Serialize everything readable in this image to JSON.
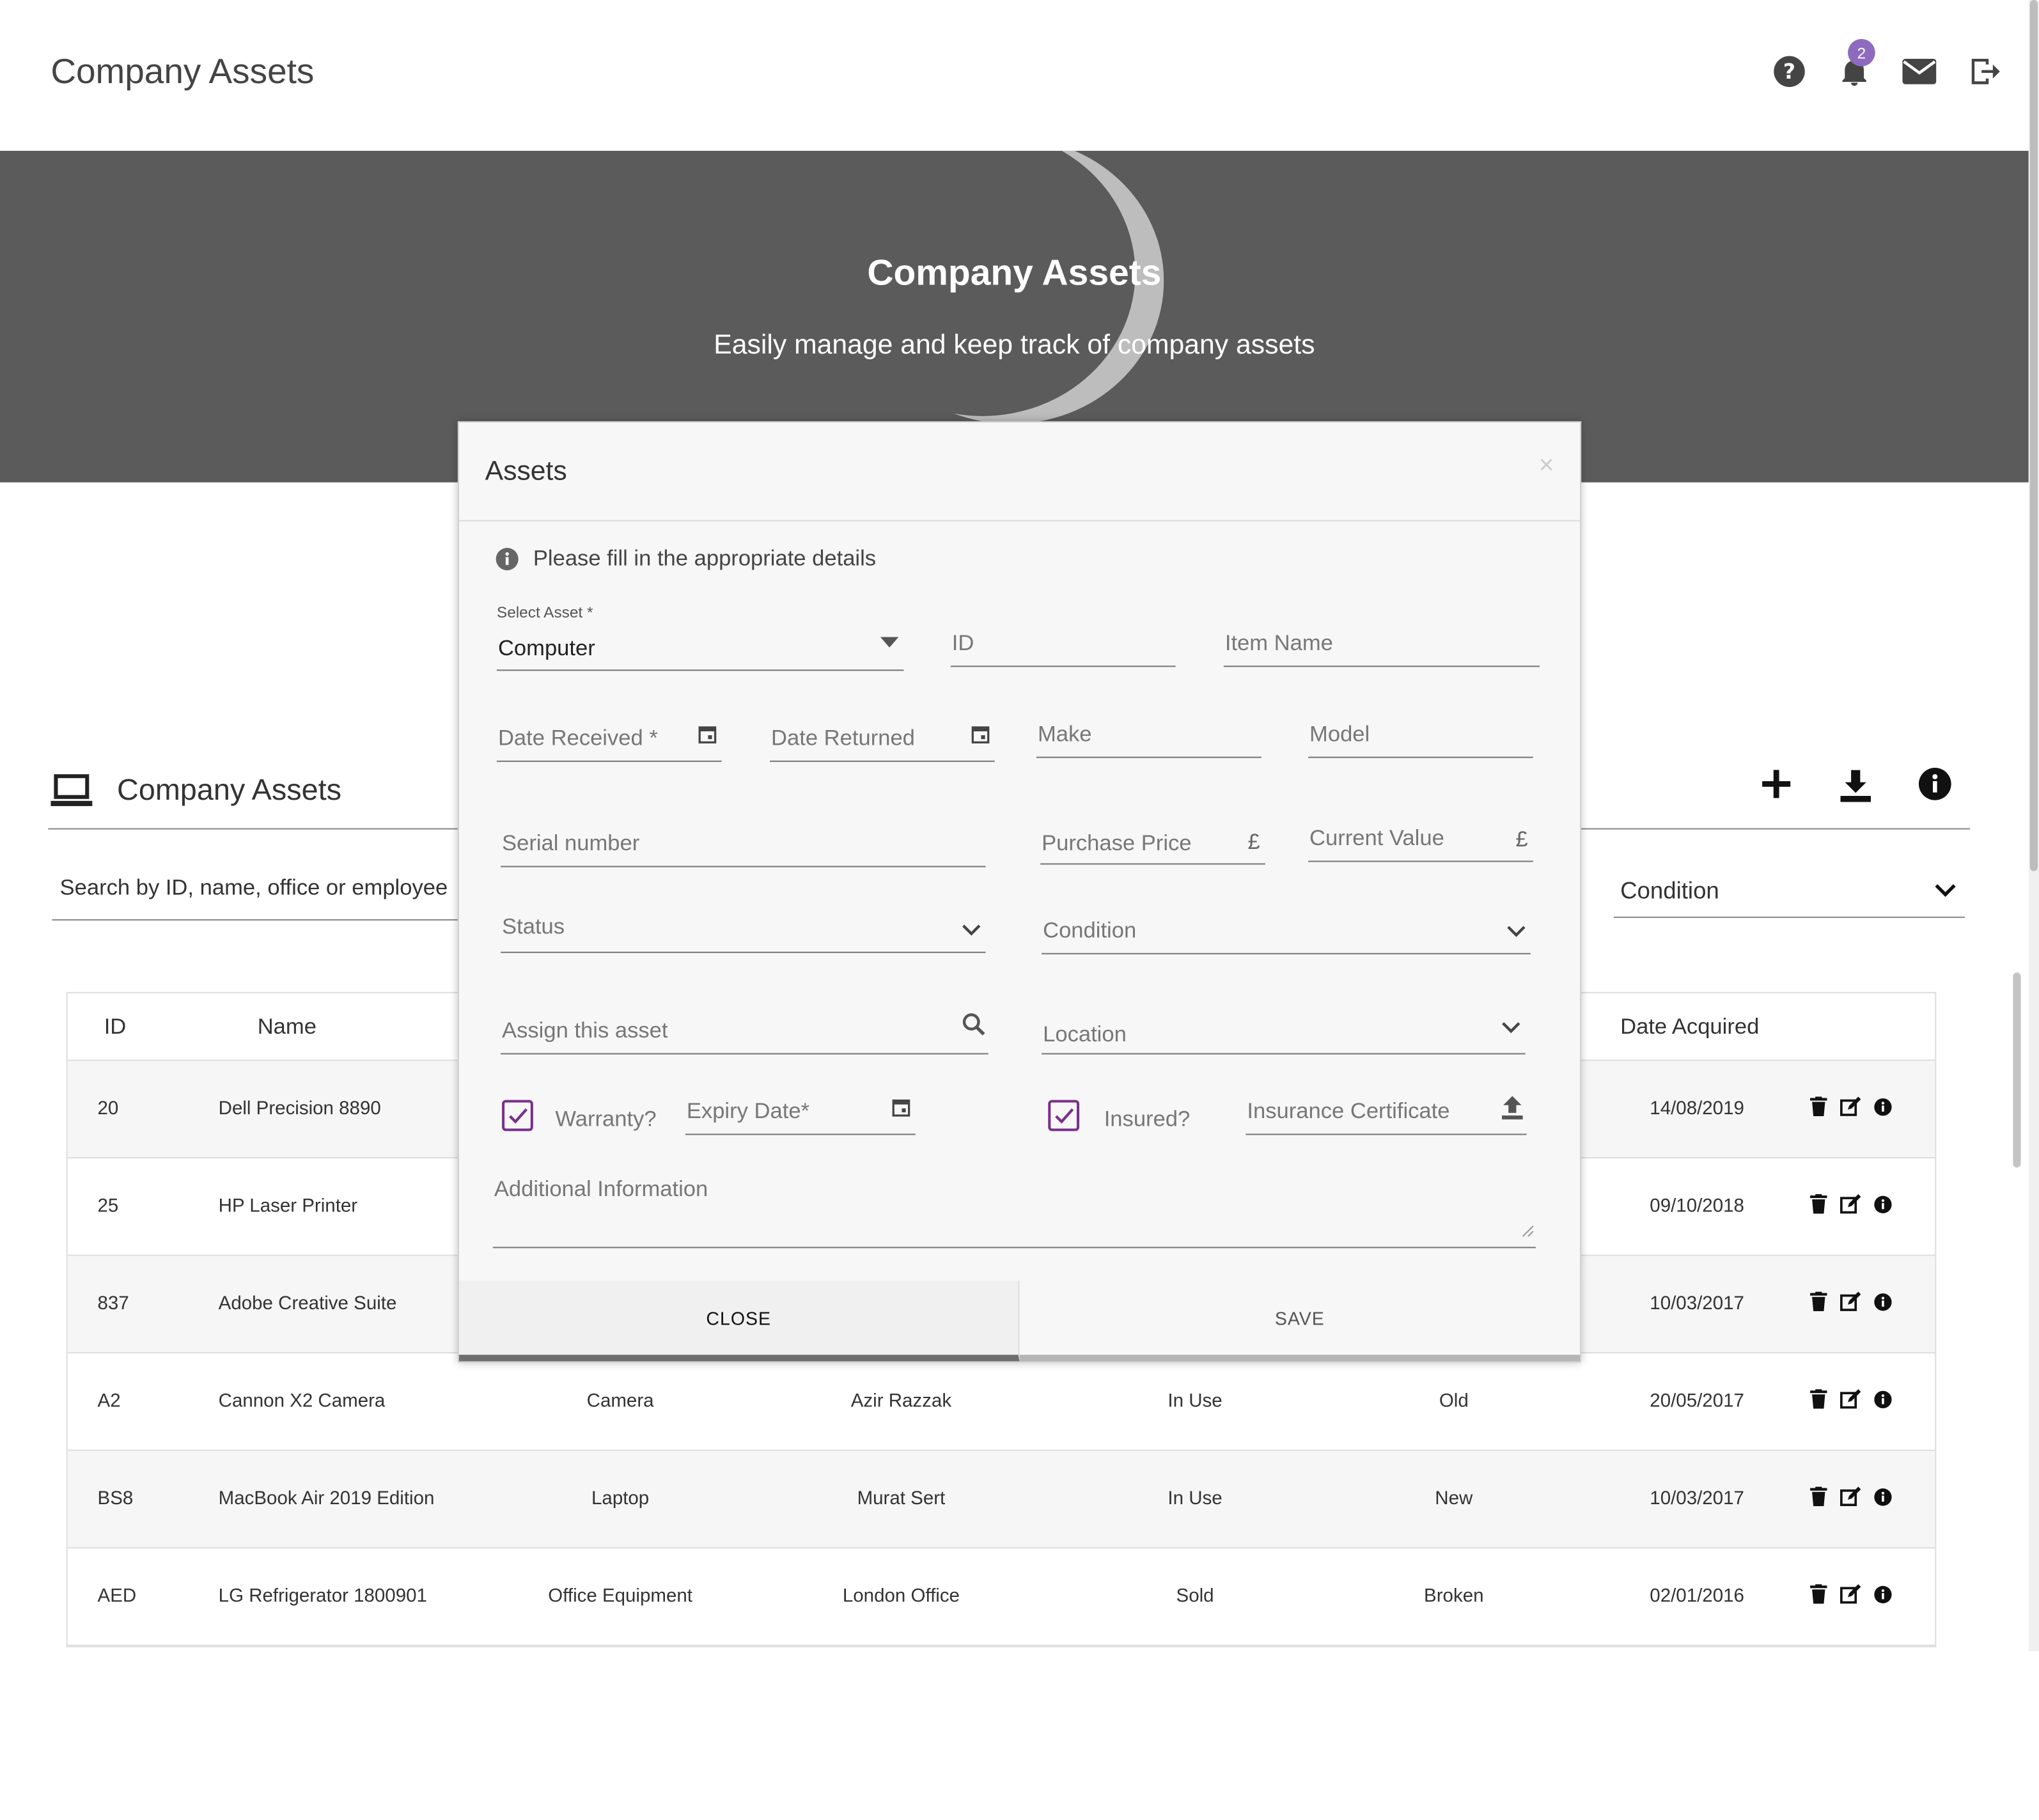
{
  "header": {
    "title": "Company Assets",
    "notification_count": "2"
  },
  "hero": {
    "title": "Company Assets",
    "subtitle": "Easily manage and keep track of company assets"
  },
  "section": {
    "title": "Company Assets"
  },
  "search": {
    "placeholder": "Search by ID, name, office or employee"
  },
  "filter": {
    "condition_label": "Condition"
  },
  "table": {
    "headers": {
      "id": "ID",
      "name": "Name",
      "date": "Date Acquired"
    },
    "rows": [
      {
        "id": "20",
        "name": "Dell Precision 8890",
        "type": "",
        "assignee": "",
        "status": "",
        "condition": "",
        "date": "14/08/2019"
      },
      {
        "id": "25",
        "name": "HP Laser Printer",
        "type": "",
        "assignee": "",
        "status": "",
        "condition": "",
        "date": "09/10/2018"
      },
      {
        "id": "837",
        "name": "Adobe Creative Suite",
        "type": "",
        "assignee": "",
        "status": "",
        "condition": "",
        "date": "10/03/2017"
      },
      {
        "id": "A2",
        "name": "Cannon X2 Camera",
        "type": "Camera",
        "assignee": "Azir Razzak",
        "status": "In Use",
        "condition": "Old",
        "date": "20/05/2017"
      },
      {
        "id": "BS8",
        "name": "MacBook Air 2019 Edition",
        "type": "Laptop",
        "assignee": "Murat Sert",
        "status": "In Use",
        "condition": "New",
        "date": "10/03/2017"
      },
      {
        "id": "AED",
        "name": "LG Refrigerator 1800901",
        "type": "Office Equipment",
        "assignee": "London Office",
        "status": "Sold",
        "condition": "Broken",
        "date": "02/01/2016"
      }
    ]
  },
  "modal": {
    "title": "Assets",
    "close_x": "×",
    "info": "Please fill in the appropriate details",
    "select_asset_label": "Select Asset *",
    "select_asset_value": "Computer",
    "id_placeholder": "ID",
    "item_name_placeholder": "Item Name",
    "date_received_placeholder": "Date Received *",
    "date_returned_placeholder": "Date Returned",
    "make_placeholder": "Make",
    "model_placeholder": "Model",
    "serial_placeholder": "Serial number",
    "purchase_price_placeholder": "Purchase Price",
    "current_value_placeholder": "Current Value",
    "currency": "£",
    "status_placeholder": "Status",
    "condition_placeholder": "Condition",
    "assign_placeholder": "Assign this asset",
    "location_placeholder": "Location",
    "warranty_label": "Warranty?",
    "expiry_placeholder": "Expiry Date*",
    "insured_label": "Insured?",
    "insurance_placeholder": "Insurance Certificate",
    "additional_placeholder": "Additional Information",
    "close_button": "CLOSE",
    "save_button": "SAVE"
  },
  "colors": {
    "hero_bg": "#5b5b5b",
    "badge": "#8e6bbf",
    "checkbox": "#7b2f8e"
  }
}
